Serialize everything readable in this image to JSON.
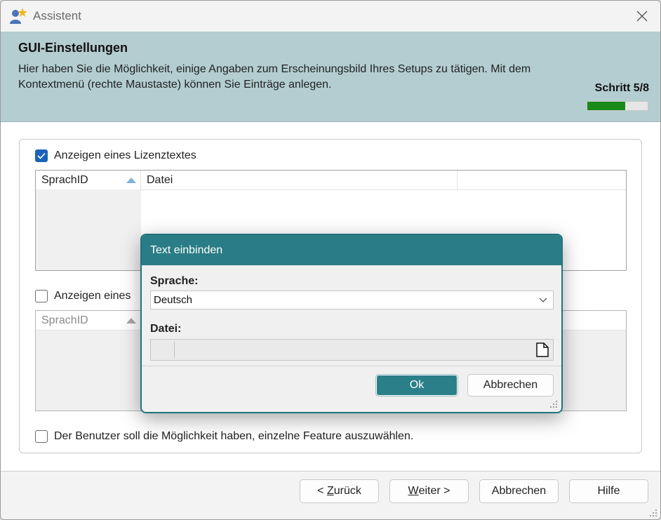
{
  "window": {
    "title": "Assistent"
  },
  "header": {
    "title": "GUI-Einstellungen",
    "description": "Hier haben Sie die Möglichkeit, einige Angaben zum Erscheinungsbild Ihres Setups zu tätigen. Mit dem Kontextmenü (rechte Maustaste) können Sie Einträge anlegen.",
    "step_label": "Schritt 5/8",
    "progress_fraction": 0.625,
    "progress_color": "#198a19"
  },
  "section_license": {
    "checkbox_label": "Anzeigen eines Lizenztextes",
    "checked": true,
    "columns": [
      "SprachID",
      "Datei"
    ]
  },
  "section_second": {
    "checkbox_label": "Anzeigen eines",
    "checked": false,
    "columns": [
      "SprachID"
    ]
  },
  "section_features": {
    "checkbox_label": "Der Benutzer soll die Möglichkeit haben, einzelne Feature auszuwählen.",
    "checked": false
  },
  "footer": {
    "back_prefix": "< ",
    "back_mnemonic": "Z",
    "back_rest": "urück",
    "next_mnemonic": "W",
    "next_rest": "eiter >",
    "cancel_label": "Abbrechen",
    "help_label": "Hilfe"
  },
  "dialog": {
    "title": "Text einbinden",
    "language_label": "Sprache:",
    "language_value": "Deutsch",
    "file_label": "Datei:",
    "file_value": "",
    "ok_label": "Ok",
    "cancel_label": "Abbrechen"
  },
  "colors": {
    "header_bg": "#b3cdd0",
    "dialog_accent": "#2a7c86",
    "checkbox_checked": "#1c63b8"
  },
  "icons": [
    "assistant-icon",
    "close-icon",
    "sort-up-icon",
    "chevron-down-icon",
    "file-icon",
    "resize-grip-icon",
    "checkmark-icon"
  ]
}
